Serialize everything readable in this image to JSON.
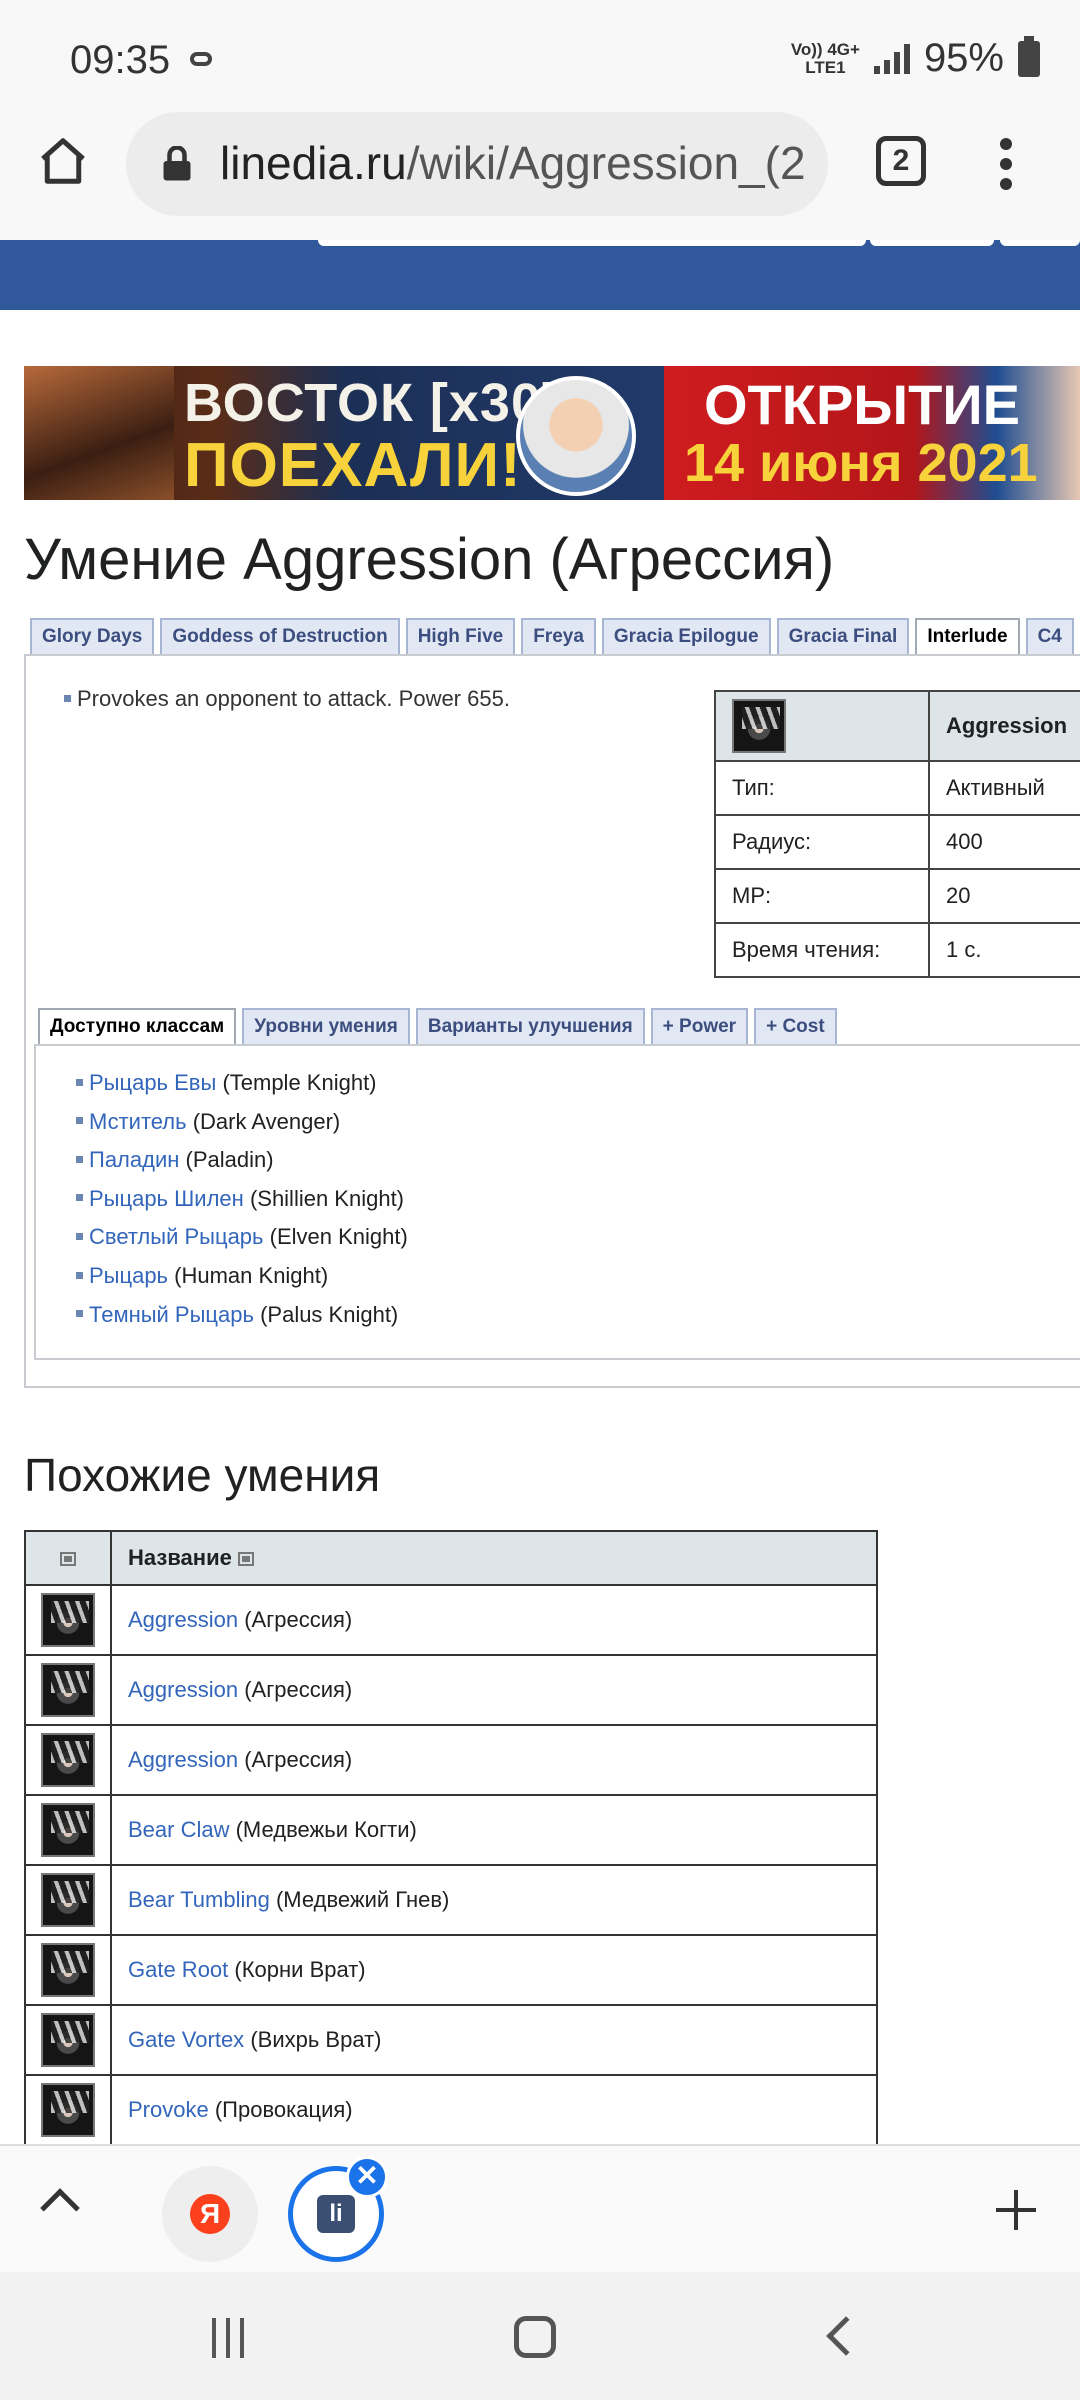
{
  "status_bar": {
    "time": "09:35",
    "network_top": "Vo)) 4G+",
    "network_bottom": "LTE1",
    "battery": "95%"
  },
  "browser": {
    "url_domain": "linedia.ru",
    "url_path": "/wiki/Aggression_(2",
    "tab_count": "2"
  },
  "banner": {
    "line1": "ВОСТОК [x30]",
    "line2": "ПОЕХАЛИ!",
    "line3": "ОТКРЫТИЕ",
    "line4": "14 июня 2021"
  },
  "page": {
    "title": "Умение Aggression (Агрессия)"
  },
  "version_tabs": [
    {
      "label": "Glory Days"
    },
    {
      "label": "Goddess of Destruction"
    },
    {
      "label": "High Five"
    },
    {
      "label": "Freya"
    },
    {
      "label": "Gracia Epilogue"
    },
    {
      "label": "Gracia Final"
    },
    {
      "label": "Interlude"
    },
    {
      "label": "C4"
    }
  ],
  "active_version": "Interlude",
  "description": "Provokes an opponent to attack. Power 655.",
  "info_table": {
    "name": "Aggression",
    "rows": [
      {
        "label": "Тип:",
        "value": "Активный"
      },
      {
        "label": "Радиус:",
        "value": "400"
      },
      {
        "label": "MP:",
        "value": "20"
      },
      {
        "label": "Время чтения:",
        "value": "1 с."
      }
    ]
  },
  "class_tabs": [
    {
      "label": "Доступно классам"
    },
    {
      "label": "Уровни умения"
    },
    {
      "label": "Варианты улучшения"
    },
    {
      "label": "+ Power"
    },
    {
      "label": "+ Cost"
    }
  ],
  "classes": [
    {
      "name": "Рыцарь Евы",
      "en": "(Temple Knight)"
    },
    {
      "name": "Мститель",
      "en": "(Dark Avenger)"
    },
    {
      "name": "Паладин",
      "en": "(Paladin)"
    },
    {
      "name": "Рыцарь Шилен",
      "en": "(Shillien Knight)"
    },
    {
      "name": "Светлый Рыцарь",
      "en": "(Elven Knight)"
    },
    {
      "name": "Рыцарь",
      "en": "(Human Knight)"
    },
    {
      "name": "Темный Рыцарь",
      "en": "(Palus Knight)"
    }
  ],
  "similar": {
    "title": "Похожие умения",
    "header_name": "Название",
    "rows": [
      {
        "name": "Aggression",
        "ru": "(Агрессия)"
      },
      {
        "name": "Aggression",
        "ru": "(Агрессия)"
      },
      {
        "name": "Aggression",
        "ru": "(Агрессия)"
      },
      {
        "name": "Bear Claw",
        "ru": "(Медвежьи Когти)"
      },
      {
        "name": "Bear Tumbling",
        "ru": "(Медвежий Гнев)"
      },
      {
        "name": "Gate Root",
        "ru": "(Корни Врат)"
      },
      {
        "name": "Gate Vortex",
        "ru": "(Вихрь Врат)"
      },
      {
        "name": "Provoke",
        "ru": "(Провокация)"
      }
    ]
  },
  "bottom_bar": {
    "yandex_logo": "Я",
    "linedia_logo": "li",
    "close": "✕"
  },
  "icons": [
    "home-icon",
    "lock-icon",
    "tabs-icon",
    "menu-icon",
    "skill-icon",
    "sort-icon",
    "up-icon",
    "plus-icon",
    "close-icon"
  ]
}
